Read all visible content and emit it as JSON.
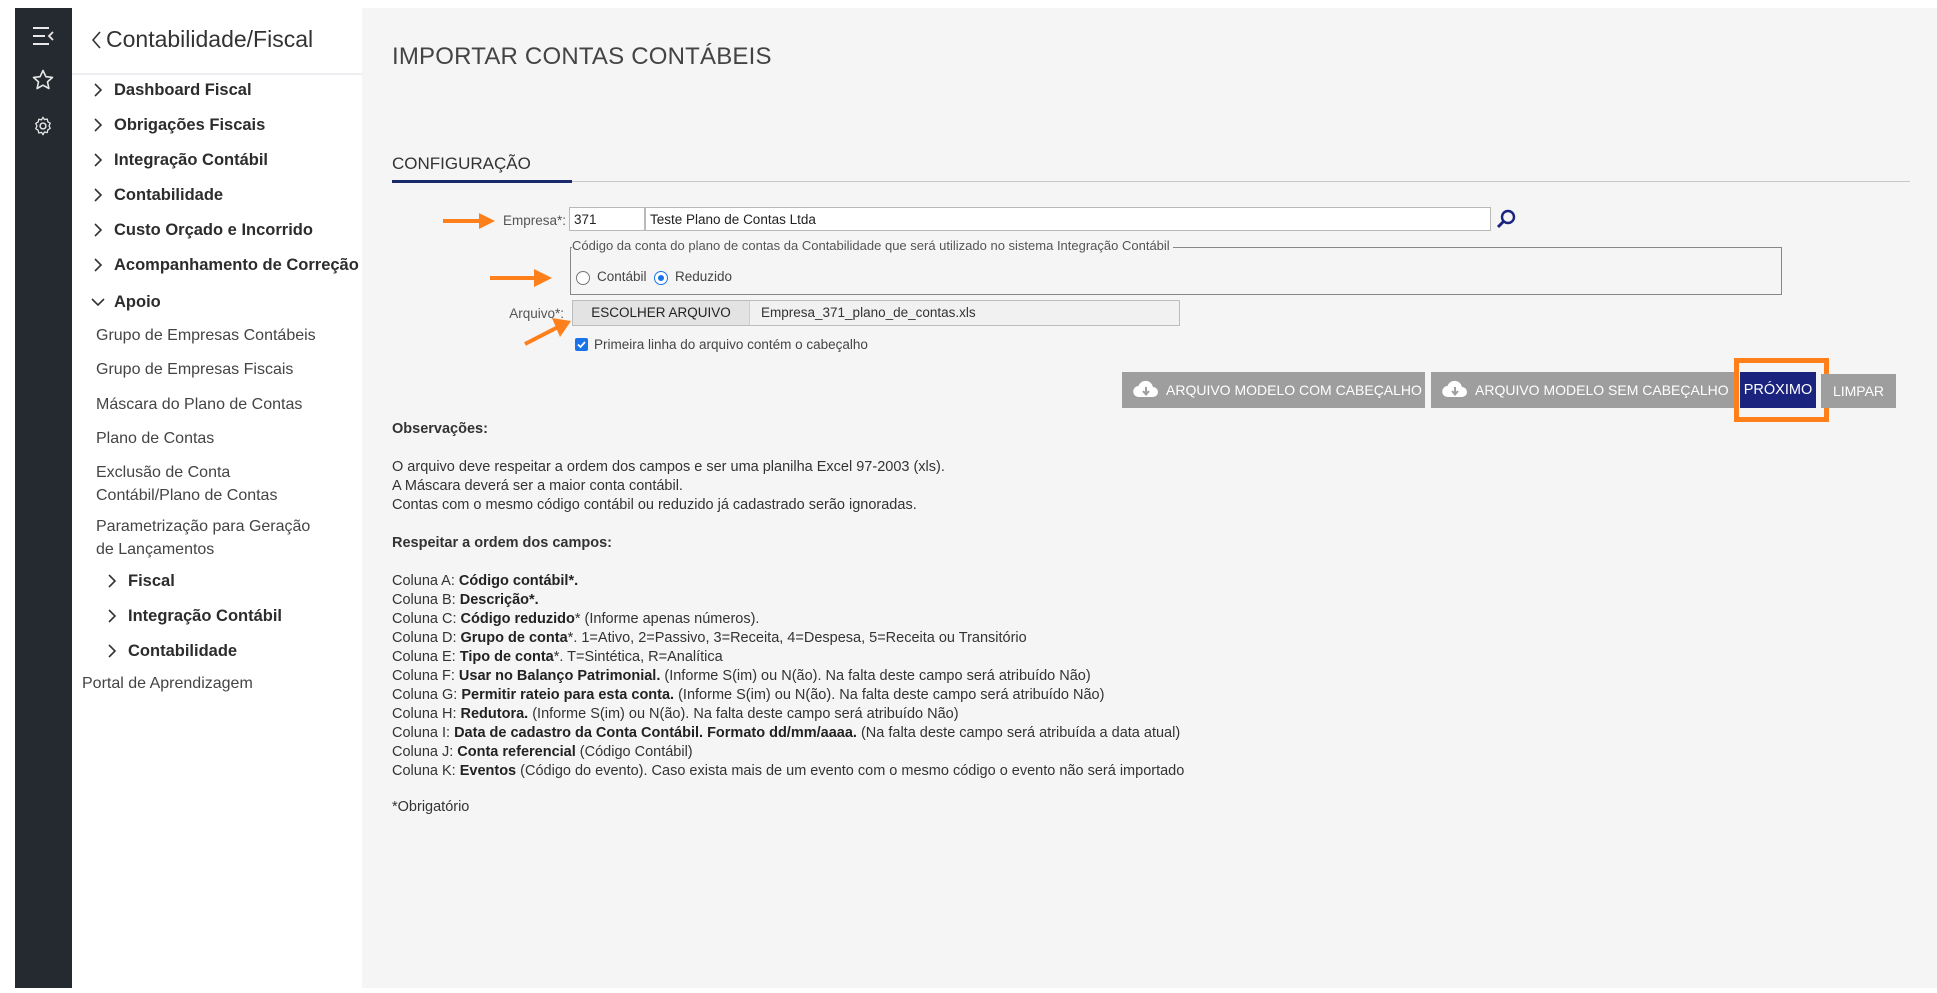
{
  "sidebar": {
    "back_label": "Contabilidade/Fiscal",
    "items": [
      {
        "label": "Dashboard Fiscal"
      },
      {
        "label": "Obrigações Fiscais"
      },
      {
        "label": "Integração Contábil"
      },
      {
        "label": "Contabilidade"
      },
      {
        "label": "Custo Orçado e Incorrido"
      },
      {
        "label": "Acompanhamento de Correção"
      },
      {
        "label": "Apoio"
      }
    ],
    "apoio_sub": [
      "Grupo de Empresas Contábeis",
      "Grupo de Empresas Fiscais",
      "Máscara do Plano de Contas",
      "Plano de Contas",
      "Exclusão de Conta",
      "Contábil/Plano de Contas",
      "Parametrização para Geração",
      "de Lançamentos"
    ],
    "apoio_groups": [
      "Fiscal",
      "Integração Contábil",
      "Contabilidade"
    ],
    "portal_label": "Portal de Aprendizagem"
  },
  "page": {
    "title": "IMPORTAR CONTAS CONTÁBEIS",
    "section": "CONFIGURAÇÃO"
  },
  "form": {
    "empresa_label": "Empresa*:",
    "empresa_code": "371",
    "empresa_name": "Teste Plano de Contas Ltda",
    "conta_legend": "Código da conta do plano de contas da Contabilidade que será utilizado no sistema Integração Contábil",
    "radio_contabil": "Contábil",
    "radio_reduzido": "Reduzido",
    "radio_selected": "Reduzido",
    "arquivo_label": "Arquivo*:",
    "file_button": "ESCOLHER ARQUIVO",
    "file_name": "Empresa_371_plano_de_contas.xls",
    "checkbox_label": "Primeira linha do arquivo contém o cabeçalho",
    "checkbox_checked": true
  },
  "actions": {
    "modelo_com": "ARQUIVO MODELO COM CABEÇALHO",
    "modelo_sem": "ARQUIVO MODELO SEM CABEÇALHO",
    "proximo": "PRÓXIMO",
    "limpar": "LIMPAR"
  },
  "notes": {
    "obs_title": "Observações:",
    "obs_lines": [
      "O arquivo deve respeitar a ordem dos campos e ser uma planilha Excel 97-2003 (xls).",
      "A Máscara deverá ser a maior conta contábil.",
      "Contas com o mesmo código contábil ou reduzido já cadastrado serão ignoradas."
    ],
    "order_title": "Respeitar a ordem dos campos:",
    "columns": [
      {
        "prefix": "Coluna A: ",
        "bold": "Código contábil*.",
        "rest": ""
      },
      {
        "prefix": "Coluna B: ",
        "bold": "Descrição*.",
        "rest": ""
      },
      {
        "prefix": "Coluna C: ",
        "bold": "Código reduzido",
        "rest": "* (Informe apenas números)."
      },
      {
        "prefix": "Coluna D: ",
        "bold": "Grupo de conta",
        "rest": "*. 1=Ativo, 2=Passivo, 3=Receita, 4=Despesa, 5=Receita ou Transitório"
      },
      {
        "prefix": "Coluna E: ",
        "bold": "Tipo de conta",
        "rest": "*. T=Sintética, R=Analítica"
      },
      {
        "prefix": "Coluna F: ",
        "bold": "Usar no Balanço Patrimonial.",
        "rest": " (Informe S(im) ou N(ão). Na falta deste campo será atribuído Não)"
      },
      {
        "prefix": "Coluna G: ",
        "bold": "Permitir rateio para esta conta.",
        "rest": " (Informe S(im) ou N(ão). Na falta deste campo será atribuído Não)"
      },
      {
        "prefix": "Coluna H: ",
        "bold": "Redutora.",
        "rest": " (Informe S(im) ou N(ão). Na falta deste campo será atribuído Não)"
      },
      {
        "prefix": "Coluna I: ",
        "bold": "Data de cadastro da Conta Contábil. Formato dd/mm/aaaa.",
        "rest": " (Na falta deste campo será atribuída a data atual)"
      },
      {
        "prefix": "Coluna J: ",
        "bold": "Conta referencial",
        "rest": " (Código Contábil)"
      },
      {
        "prefix": "Coluna K: ",
        "bold": "Eventos",
        "rest": " (Código do evento). Caso exista mais de um evento com o mesmo código o evento não será importado"
      }
    ],
    "required_note": "*Obrigatório"
  },
  "icons": [
    "menu-collapse-icon",
    "star-icon",
    "gear-icon",
    "search-icon",
    "cloud-download-icon",
    "chevron-right-icon",
    "chevron-down-icon",
    "chevron-left-icon"
  ],
  "colors": {
    "rail": "#252a30",
    "primary": "#1a237e",
    "gray_button": "#9e9e9e",
    "highlight": "#ff7f1a",
    "radio_accent": "#1a73e8"
  }
}
